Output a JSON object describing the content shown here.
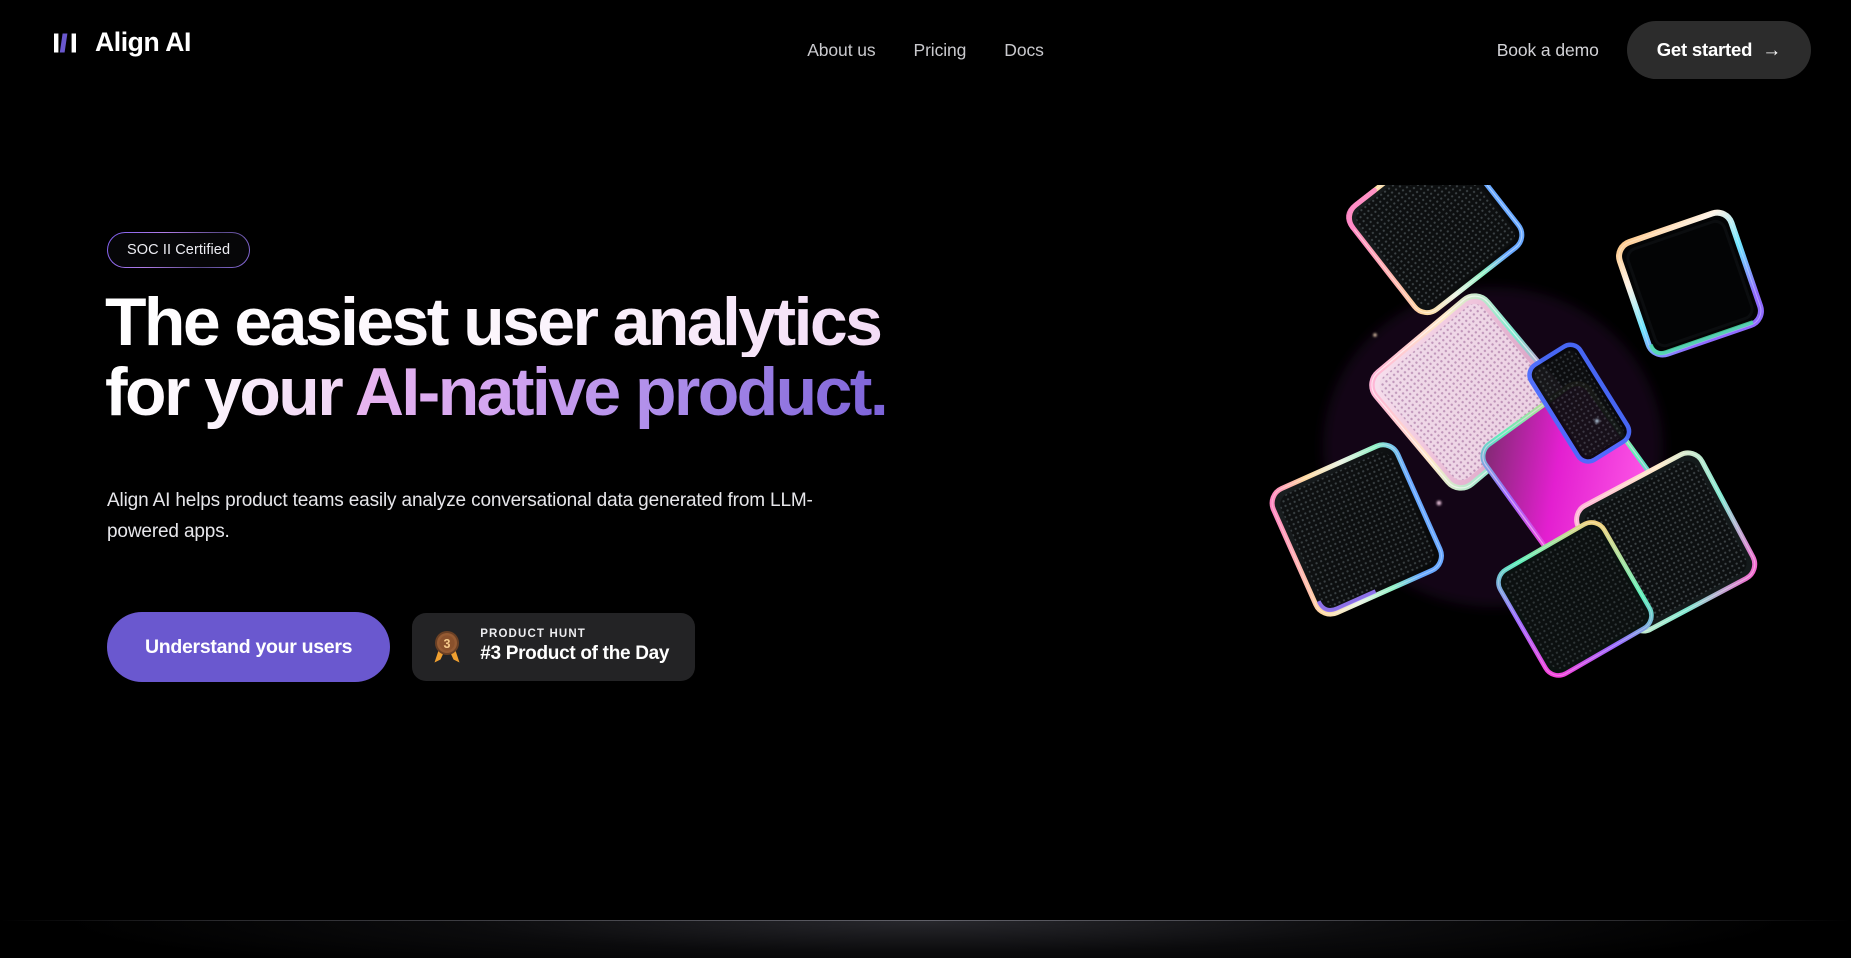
{
  "brand": {
    "name": "Align AI",
    "logo_icon": "three-bars-logo-icon",
    "logo_bar_colors": [
      "#ffffff",
      "#6a58cf",
      "#ffffff"
    ]
  },
  "nav": {
    "links": [
      {
        "label": "About us"
      },
      {
        "label": "Pricing"
      },
      {
        "label": "Docs"
      }
    ],
    "demo_label": "Book a demo",
    "get_started_label": "Get started",
    "get_started_arrow": "→",
    "get_started_bg": "#2c2c2c"
  },
  "hero": {
    "badge": {
      "label": "SOC II Certified",
      "border_gradient": [
        "#7b5cf0",
        "#b07de8",
        "#5a4a8a",
        "#8a6ce0"
      ]
    },
    "headline_line1": "The easiest user analytics",
    "headline_line2_plain": "for your ",
    "headline_line2_accent": "AI-native product.",
    "headline_gradient_plain": [
      "#ffffff",
      "#eed2f3"
    ],
    "headline_gradient_accent": [
      "#e9b6ef",
      "#7b62d8"
    ],
    "subheadline": "Align AI helps product teams easily analyze conversational data generated from LLM-powered apps.",
    "cta_primary_label": "Understand your users",
    "cta_primary_bg": "#6a58cf",
    "product_hunt": {
      "medal_icon": "bronze-medal-icon",
      "medal_rank": "3",
      "label": "PRODUCT HUNT",
      "title": "#3 Product of the Day",
      "bg": "#232325"
    }
  },
  "artwork": {
    "name": "iridescent-3d-cubes-graphic",
    "description": "Cluster of rotated rounded 3D slabs with chromatic iridescent edges and perforated dot texture",
    "edge_colors": [
      "#ff8fcf",
      "#ffb45a",
      "#7bf0c0",
      "#5a8cff",
      "#ff2fd4",
      "#c9a6ff"
    ]
  },
  "background": {
    "page_bg": "#000000"
  }
}
